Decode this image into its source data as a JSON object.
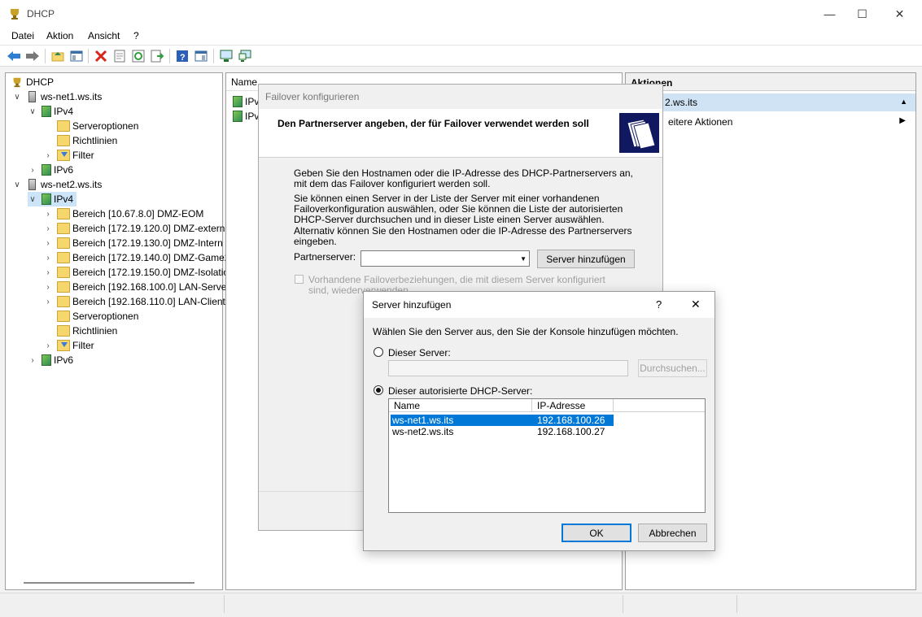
{
  "window": {
    "title": "DHCP"
  },
  "menu": [
    "Datei",
    "Aktion",
    "Ansicht",
    "?"
  ],
  "tree": {
    "root": "DHCP",
    "server1": "ws-net1.ws.its",
    "s1_ipv4": "IPv4",
    "s1_serveroptionen": "Serveroptionen",
    "s1_richtlinien": "Richtlinien",
    "s1_filter": "Filter",
    "s1_ipv6": "IPv6",
    "server2": "ws-net2.ws.its",
    "s2_ipv4": "IPv4",
    "scopes": [
      "Bereich [10.67.8.0] DMZ-EOM",
      "Bereich [172.19.120.0] DMZ-extern",
      "Bereich [172.19.130.0] DMZ-Intern",
      "Bereich [172.19.140.0] DMZ-Game2",
      "Bereich [172.19.150.0] DMZ-Isolatio",
      "Bereich [192.168.100.0] LAN-Server",
      "Bereich [192.168.110.0] LAN-Client"
    ],
    "s2_serveroptionen": "Serveroptionen",
    "s2_richtlinien": "Richtlinien",
    "s2_filter": "Filter",
    "s2_ipv6": "IPv6"
  },
  "middle": {
    "col_name": "Name",
    "items": [
      "IPv",
      "IPv"
    ]
  },
  "actions": {
    "header": "Aktionen",
    "selected": "2.ws.its",
    "more": "eitere Aktionen"
  },
  "failover": {
    "title": "Failover konfigurieren",
    "heading": "Den Partnerserver angeben, der für Failover verwendet werden soll",
    "p1": "Geben Sie den Hostnamen oder die IP-Adresse des DHCP-Partnerservers an, mit dem das Failover konfiguriert werden soll.",
    "p2": "Sie können einen Server in der Liste der Server mit einer vorhandenen Failoverkonfiguration auswählen, oder Sie können die Liste der autorisierten DHCP-Server durchsuchen und in dieser Liste einen Server auswählen.",
    "p3": "Alternativ können Sie den Hostnamen oder die IP-Adresse des Partnerservers eingeben.",
    "partner_label": "Partnerserver:",
    "partner_value": "",
    "add_button": "Server hinzufügen",
    "checkbox_label": "Vorhandene Failoverbeziehungen, die mit diesem Server konfiguriert sind, wiederverwenden"
  },
  "add_server": {
    "title": "Server hinzufügen",
    "help": "?",
    "close": "✕",
    "instruction": "Wählen Sie den Server aus, den Sie der Konsole hinzufügen möchten.",
    "radio_this": "Dieser Server:",
    "this_value": "",
    "browse": "Durchsuchen...",
    "radio_authorized": "Dieser autorisierte DHCP-Server:",
    "col_name": "Name",
    "col_ip": "IP-Adresse",
    "rows": [
      {
        "name": "ws-net1.ws.its",
        "ip": "192.168.100.26"
      },
      {
        "name": "ws-net2.ws.its",
        "ip": "192.168.100.27"
      }
    ],
    "ok": "OK",
    "cancel": "Abbrechen"
  }
}
